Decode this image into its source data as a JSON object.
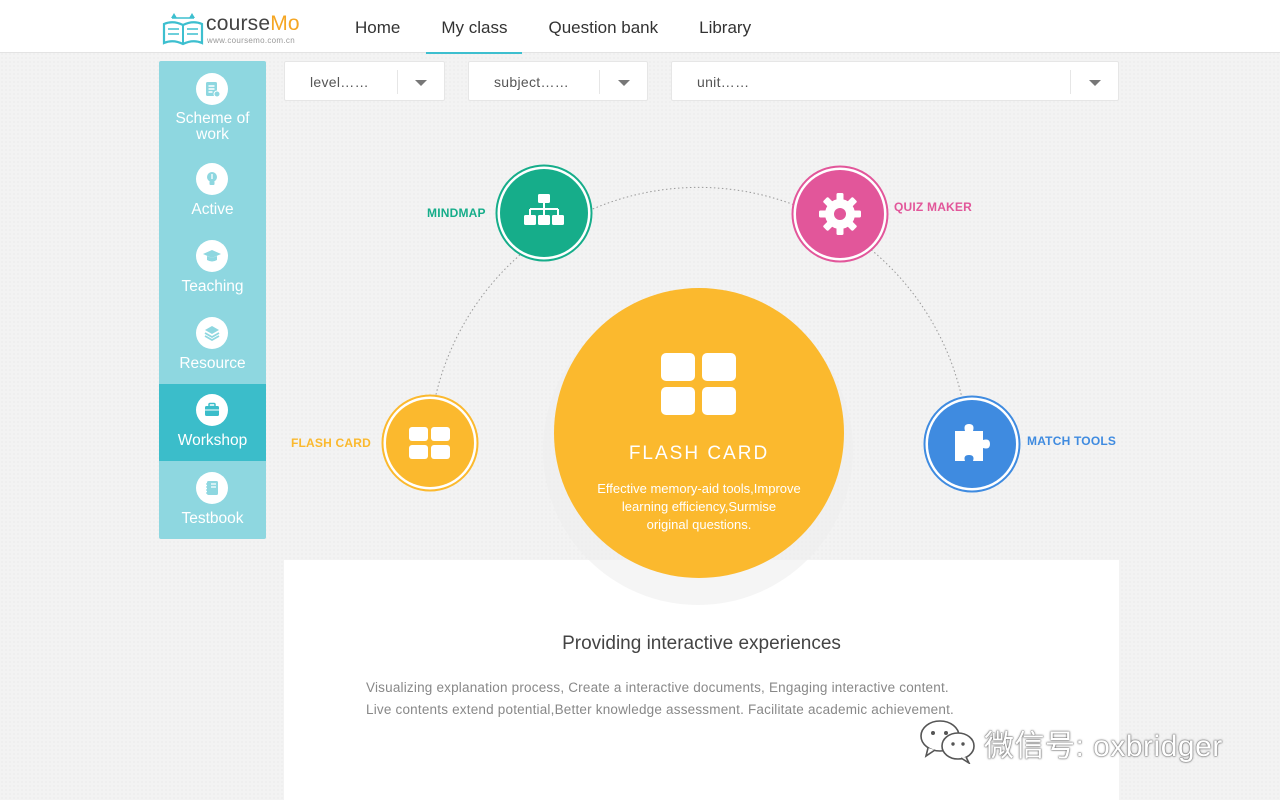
{
  "header": {
    "logo": {
      "name": "courseMo",
      "name_part1": "course",
      "name_part2": "Mo",
      "url": "www.coursemo.com.cn"
    },
    "nav": [
      {
        "label": "Home",
        "active": false
      },
      {
        "label": "My class",
        "active": true
      },
      {
        "label": "Question bank",
        "active": false
      },
      {
        "label": "Library",
        "active": false
      }
    ]
  },
  "sidebar": {
    "items": [
      {
        "label": "Scheme of work",
        "icon": "document-list-icon",
        "active": false
      },
      {
        "label": "Active",
        "icon": "lightbulb-icon",
        "active": false
      },
      {
        "label": "Teaching",
        "icon": "graduation-cap-icon",
        "active": false
      },
      {
        "label": "Resource",
        "icon": "layers-icon",
        "active": false
      },
      {
        "label": "Workshop",
        "icon": "briefcase-icon",
        "active": true
      },
      {
        "label": "Testbook",
        "icon": "notebook-icon",
        "active": false
      }
    ]
  },
  "filters": {
    "level": "level……",
    "subject": "subject……",
    "unit": "unit……"
  },
  "tools": {
    "mindmap": {
      "label": "MINDMAP",
      "color": "#16ad8a",
      "icon": "org-chart-icon"
    },
    "quiz_maker": {
      "label": "QUIZ MAKER",
      "color": "#e2569a",
      "icon": "gear-icon"
    },
    "flash_card": {
      "label": "FLASH  CARD",
      "color": "#fbb92e",
      "icon": "grid-icon"
    },
    "match_tools": {
      "label": "MATCH TOOLS",
      "color": "#3f8be0",
      "icon": "puzzle-icon"
    }
  },
  "featured": {
    "title": "FLASH  CARD",
    "desc_lines": [
      "Effective memory-aid tools,Improve",
      "learning efficiency,Surmise",
      "original questions."
    ],
    "color": "#fbb92e"
  },
  "panel": {
    "title": "Providing interactive experiences",
    "lines": [
      "Visualizing explanation process, Create a interactive documents, Engaging interactive content.",
      "Live contents extend potential,Better knowledge assessment. Facilitate academic achievement."
    ]
  },
  "watermark": {
    "text": "微信号: oxbridger"
  }
}
